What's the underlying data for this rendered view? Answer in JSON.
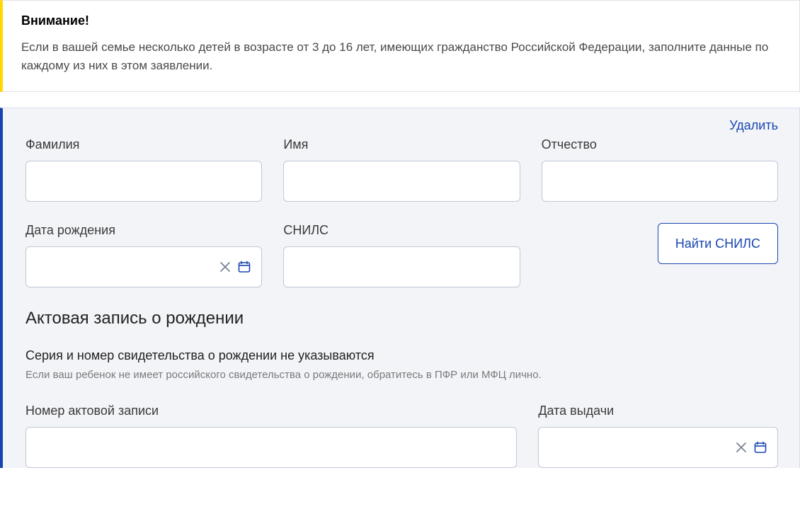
{
  "alert": {
    "title": "Внимание!",
    "text": "Если в вашей семье несколько детей в возрасте от 3 до 16 лет, имеющих гражданство Российской Федерации, заполните данные по каждому из них в этом заявлении."
  },
  "form": {
    "delete_label": "Удалить",
    "fields": {
      "surname_label": "Фамилия",
      "surname_value": "",
      "name_label": "Имя",
      "name_value": "",
      "patronymic_label": "Отчество",
      "patronymic_value": "",
      "birthdate_label": "Дата рождения",
      "birthdate_value": "",
      "snils_label": "СНИЛС",
      "snils_value": "",
      "find_snils_label": "Найти СНИЛС"
    },
    "birth_record": {
      "heading": "Актовая запись о рождении",
      "sub_heading": "Серия и номер свидетельства о рождении не указываются",
      "help_text": "Если ваш ребенок не имеет российского свидетельства о рождении, обратитесь в ПФР или МФЦ лично.",
      "record_number_label": "Номер актовой записи",
      "record_number_value": "",
      "issue_date_label": "Дата выдачи",
      "issue_date_value": ""
    }
  },
  "icons": {
    "clear": "close-icon",
    "calendar": "calendar-icon"
  }
}
